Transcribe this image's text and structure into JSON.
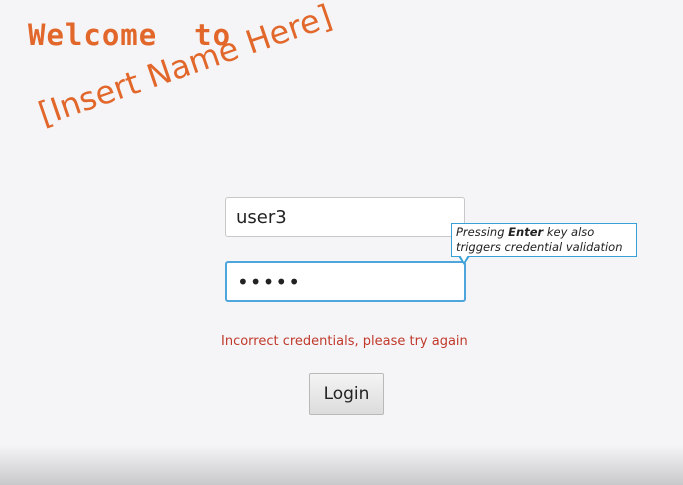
{
  "header": {
    "welcome": "Welcome  to",
    "app_name": "[Insert Name Here]"
  },
  "form": {
    "username_value": "user3",
    "password_value": "•••••",
    "error_message": "Incorrect credentials, please try again",
    "login_label": "Login"
  },
  "tooltip": {
    "line1_before": "Pressing ",
    "line1_key": "Enter",
    "line1_after": " key also",
    "line2": "triggers credential validation"
  },
  "colors": {
    "brand": "#e2672a",
    "error": "#c0392b",
    "focus": "#4ea6dc"
  }
}
